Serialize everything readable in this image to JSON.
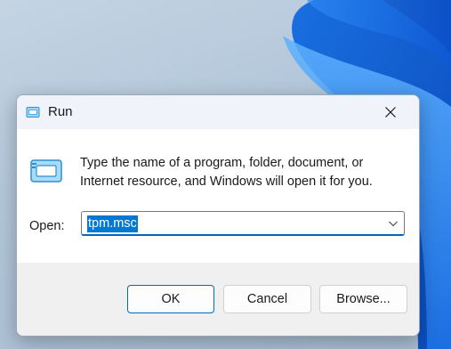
{
  "window": {
    "title": "Run",
    "title_icon": "run-icon",
    "close_icon": "close-icon"
  },
  "body": {
    "icon": "run-icon",
    "description": "Type the name of a program, folder, document, or Internet resource, and Windows will open it for you.",
    "open_label": "Open:",
    "open_value": "tpm.msc",
    "dropdown_icon": "chevron-down-icon"
  },
  "buttons": {
    "ok": "OK",
    "cancel": "Cancel",
    "browse": "Browse..."
  },
  "colors": {
    "accent": "#0078d4",
    "wallpaper": "#a9bdd2"
  }
}
